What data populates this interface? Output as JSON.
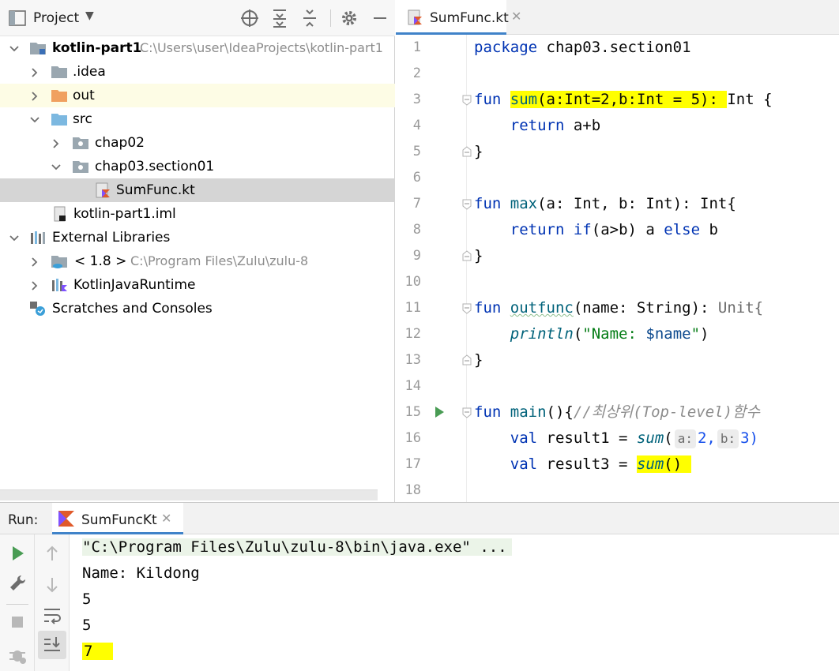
{
  "project": {
    "title": "Project",
    "tree": [
      {
        "label": "kotlin-part1",
        "path": "C:\\Users\\user\\IdeaProjects\\kotlin-part1"
      },
      {
        "label": ".idea"
      },
      {
        "label": "out"
      },
      {
        "label": "src"
      },
      {
        "label": "chap02"
      },
      {
        "label": "chap03.section01"
      },
      {
        "label": "SumFunc.kt"
      },
      {
        "label": "kotlin-part1.iml"
      },
      {
        "label": "External Libraries"
      },
      {
        "label": "< 1.8 >",
        "path": "C:\\Program Files\\Zulu\\zulu-8"
      },
      {
        "label": "KotlinJavaRuntime"
      },
      {
        "label": "Scratches and Consoles"
      }
    ]
  },
  "editor": {
    "tab_label": "SumFunc.kt",
    "line_numbers": [
      "1",
      "2",
      "3",
      "4",
      "5",
      "6",
      "7",
      "8",
      "9",
      "10",
      "11",
      "12",
      "13",
      "14",
      "15",
      "16",
      "17",
      "18"
    ],
    "code": {
      "l1_kw": "package",
      "l1_rest": " chap03.section01",
      "l3_kw": "fun",
      "l3_name": "sum",
      "l3_params": "(a:Int=2,b:Int = 5): ",
      "l3_type": "Int {",
      "l4_kw": "return",
      "l4_rest": " a+b",
      "l5": "}",
      "l7_kw": "fun",
      "l7_name": "max",
      "l7_rest": "(a: Int, b: Int): Int{",
      "l8_kw1": "return",
      "l8_kw2": "if",
      "l8_mid": "(a>b) a ",
      "l8_kw3": "else",
      "l8_end": " b",
      "l9": "}",
      "l11_kw": "fun",
      "l11_name": "outfunc",
      "l11_rest": "(name: String): ",
      "l11_type": "Unit{",
      "l12_fn": "println",
      "l12_open": "(",
      "l12_str1": "\"Name: ",
      "l12_var": "$name",
      "l12_str2": "\"",
      "l12_close": ")",
      "l13": "}",
      "l15_kw": "fun",
      "l15_name": "main",
      "l15_rest": "(){",
      "l15_comment": "//최상위(Top-level)함수",
      "l16_kw": "val",
      "l16_mid": " result1 = ",
      "l16_fn": "sum",
      "l16_open": "(",
      "l16_hint_a": "a:",
      "l16_val_a": "2,",
      "l16_hint_b": "b:",
      "l16_val_b": "3)",
      "l17_kw": "val",
      "l17_mid": " result3 = ",
      "l17_fn": "sum",
      "l17_paren": "() "
    }
  },
  "run": {
    "label": "Run:",
    "tab_label": "SumFuncKt",
    "console": [
      "\"C:\\Program Files\\Zulu\\zulu-8\\bin\\java.exe\" ...",
      "Name: Kildong",
      "5",
      "5",
      "7"
    ]
  },
  "colors": {
    "accent_tab": "#4083c9",
    "highlight": "#ffff00",
    "keyword": "#0033b3",
    "function": "#00627a",
    "string": "#067d17"
  }
}
